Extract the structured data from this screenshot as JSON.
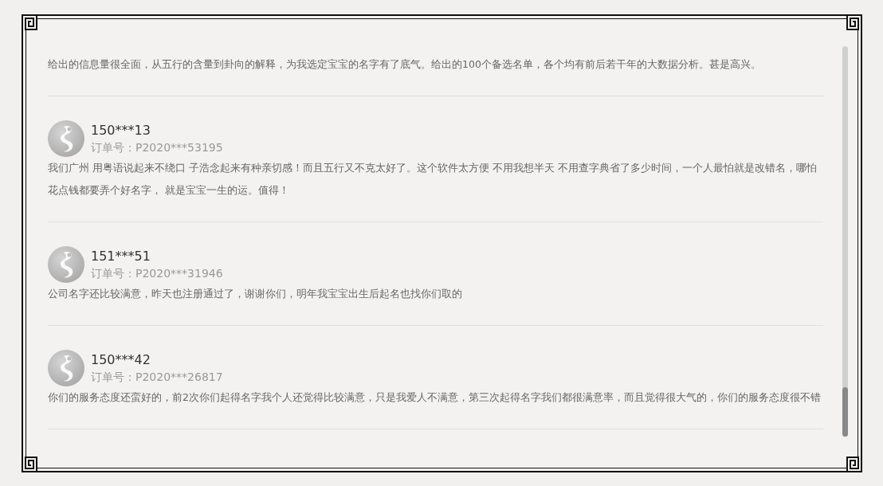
{
  "reviews": [
    {
      "kind": "partial",
      "comment": "给出的信息量很全面，从五行的含量到卦向的解释，为我选定宝宝的名字有了底气。给出的100个备选名单，各个均有前后若干年的大数据分析。甚是高兴。"
    },
    {
      "kind": "full",
      "user": "150***13",
      "order": "订单号：P2020***53195",
      "comment": "我们广州 用粤语说起来不绕口 子浩念起来有种亲切感！而且五行又不克太好了。这个软件太方便 不用我想半天 不用查字典省了多少时间，一个人最怕就是改错名，哪怕花点钱都要弄个好名字， 就是宝宝一生的运。值得！"
    },
    {
      "kind": "full",
      "user": "151***51",
      "order": "订单号：P2020***31946",
      "comment": "公司名字还比较满意，昨天也注册通过了，谢谢你们，明年我宝宝出生后起名也找你们取的"
    },
    {
      "kind": "full",
      "user": "150***42",
      "order": "订单号：P2020***26817",
      "comment": "你们的服务态度还蛮好的，前2次你们起得名字我个人还觉得比较满意，只是我爱人不满意，第三次起得名字我们都很满意率，而且觉得很大气的，你们的服务态度很不错"
    }
  ]
}
